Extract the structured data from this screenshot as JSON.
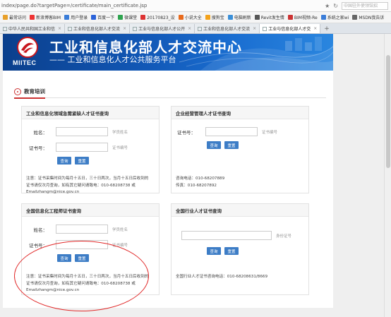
{
  "browser": {
    "url": "index/page.do?targetPage=/certificate/main_certificate.jsp",
    "search_placeholder": "中国驻外使领馆招",
    "bookmarks": [
      {
        "label": "最常访问",
        "color": "#e8a02a"
      },
      {
        "label": "新浪博客BIM",
        "color": "#e33"
      },
      {
        "label": "用户登录",
        "color": "#3b7dd8"
      },
      {
        "label": "百度一下",
        "color": "#2a62d9"
      },
      {
        "label": "微课堂",
        "color": "#2ea44f"
      },
      {
        "label": "20170823_设",
        "color": "#d33"
      },
      {
        "label": "小说大全",
        "color": "#e86a1c"
      },
      {
        "label": "搜狗宝",
        "color": "#f3a21b"
      },
      {
        "label": "电脑刷新",
        "color": "#3a8fd8"
      },
      {
        "label": "Revit发生情",
        "color": "#555"
      },
      {
        "label": "BIM视频-Re",
        "color": "#c33"
      },
      {
        "label": "系统之家wi",
        "color": "#3b7dd8"
      },
      {
        "label": "MSDN我告诉",
        "color": "#666"
      }
    ],
    "tabs": [
      {
        "label": "中华人民共和国工业和信",
        "active": false
      },
      {
        "label": "工业和信息化部人才交流",
        "active": false
      },
      {
        "label": "工业与信息化部人才公开",
        "active": false
      },
      {
        "label": "工业和信息化部人才交流",
        "active": false
      },
      {
        "label": "工业与信息化部人才交",
        "active": true
      }
    ]
  },
  "banner": {
    "logo_text": "MIITEC",
    "title": "工业和信息化部人才交流中心",
    "subtitle": "—— 工业和信息化人才公共服务平台"
  },
  "section": {
    "title": "教育培训"
  },
  "cards": {
    "emergency": {
      "title": "工业和信息化领域急需紧缺人才证书查询",
      "name_label": "姓名：",
      "name_hint": "学员姓名",
      "cert_label": "证书号：",
      "cert_hint": "证书编号",
      "query": "查询",
      "reset": "重置",
      "note1": "注意：证书采集时间为每月十五日，三十日两次，当月十五日后收到的",
      "note2": "证书请仅次月查询，如有其它疑问请致电：010-68208738 或",
      "note3": "Emailzhangm@nice.gov.cn"
    },
    "enterprise": {
      "title": "企业经营管理人才证书查询",
      "cert_label": "证书号：",
      "cert_hint": "证书编号",
      "query": "查询",
      "reset": "重置",
      "phone": "咨询电话：010-68207889",
      "fax": "传真：010-68207892"
    },
    "informatization": {
      "title": "全国信息化工程师证书查询",
      "name_label": "姓名：",
      "name_hint": "学员姓名",
      "cert_label": "证书号：",
      "cert_hint": "证书编号",
      "query": "查询",
      "reset": "重置",
      "note1": "注意：证书采集时间为每月十五日，三十日两次，当月十五日后收到的",
      "note2": "证书请仅次月查询，如有其它疑问请致电：010-68208738 或",
      "note3": "Emailzhangm@nice.gov.cn"
    },
    "industry": {
      "title": "全国行业人才证书查询",
      "cert_hint": "身份证号",
      "query": "查询",
      "reset": "重置",
      "phone": "全国行业人才证书咨询电话：010-68208631/8669"
    }
  }
}
